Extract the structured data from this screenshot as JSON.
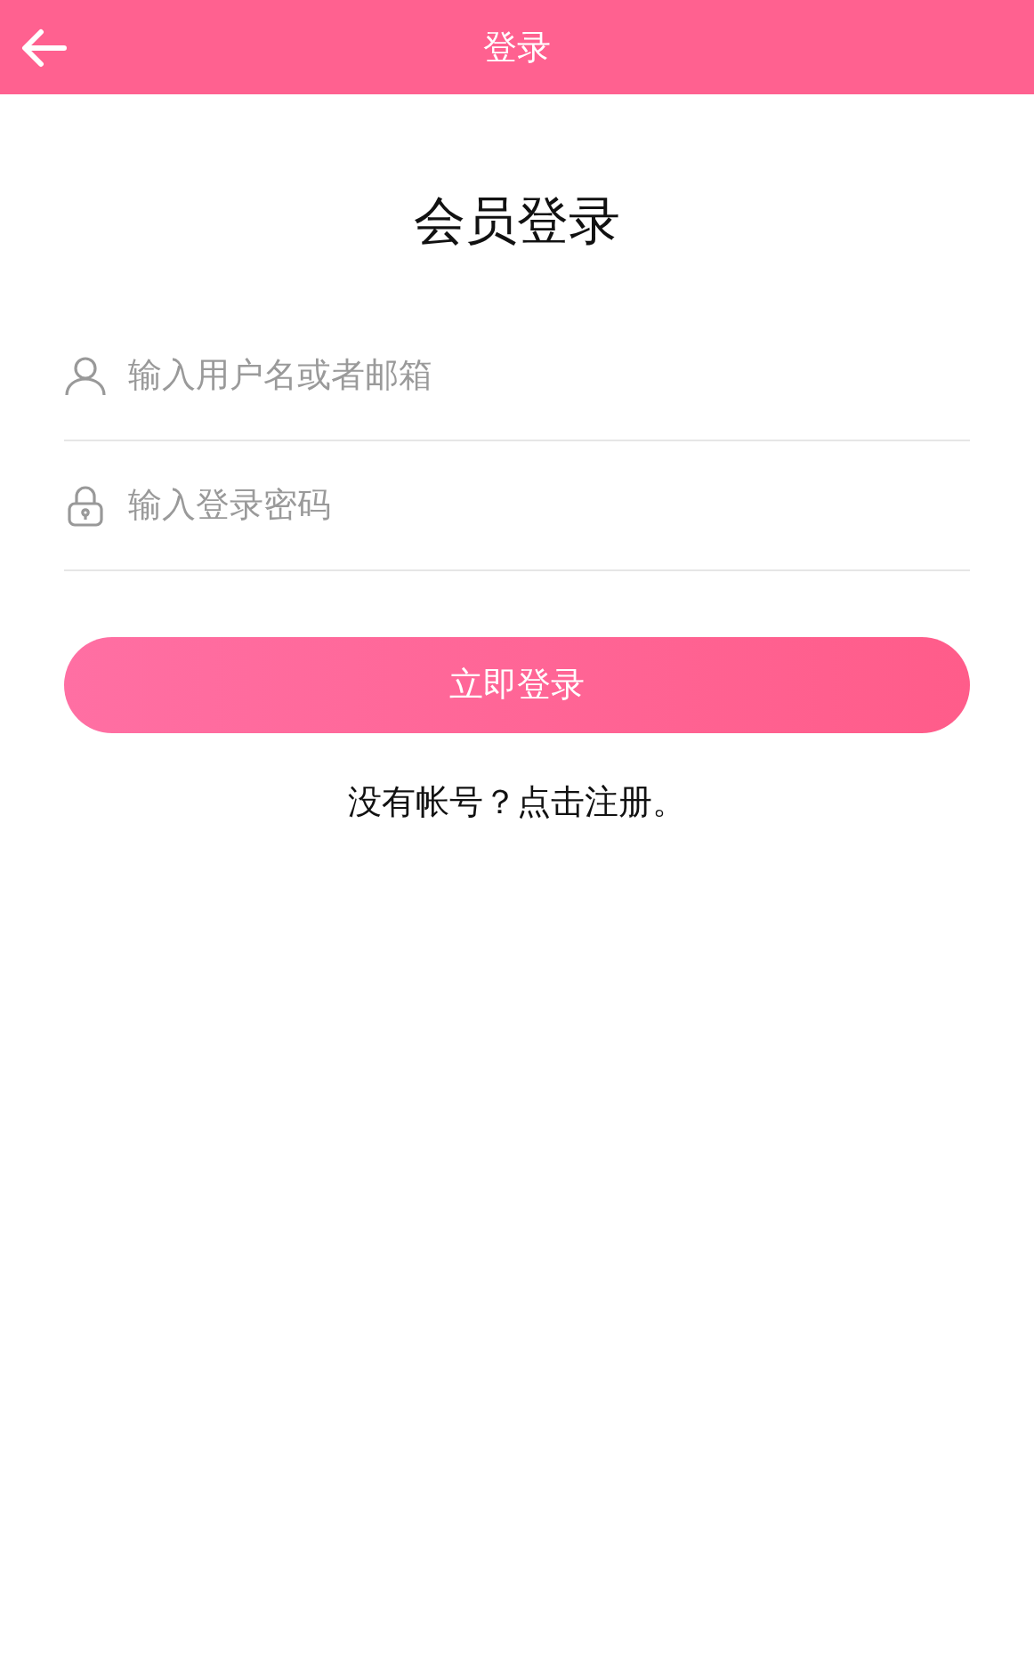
{
  "header": {
    "title": "登录"
  },
  "heading": "会员登录",
  "fields": [
    {
      "kind": "user",
      "placeholder": "输入用户名或者邮箱"
    },
    {
      "kind": "password",
      "placeholder": "输入登录密码"
    }
  ],
  "submit": "立即登录",
  "register_link": "没有帐号？点击注册。"
}
